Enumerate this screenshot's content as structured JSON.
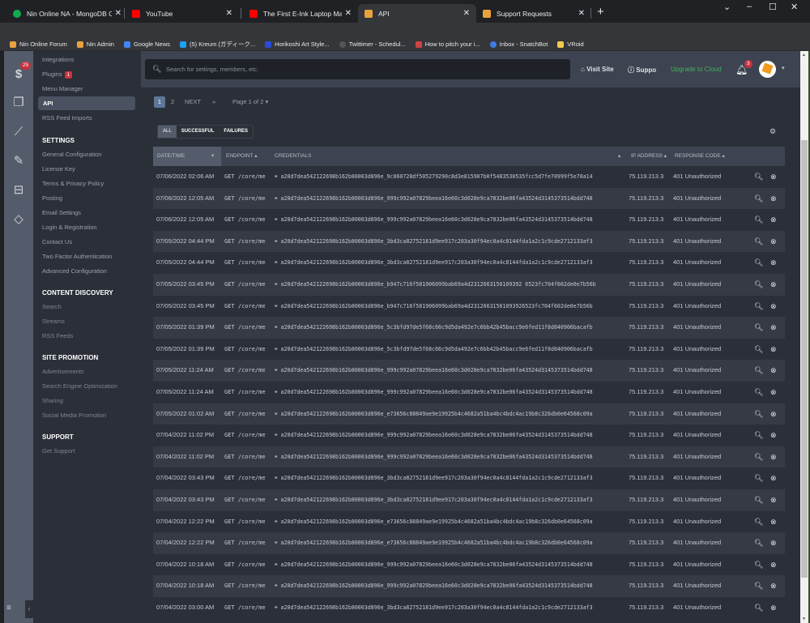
{
  "browser": {
    "tabs": [
      {
        "title": "Nin Online NA - MongoDB Charts",
        "favicon_color": "#13aa52",
        "active": false
      },
      {
        "title": "YouTube",
        "favicon_color": "#ff0000",
        "active": false
      },
      {
        "title": "The First E-Ink Laptop Makes Sen",
        "favicon_color": "#ff0000",
        "active": false
      },
      {
        "title": "API",
        "favicon_color": "#e8a33d",
        "active": true
      },
      {
        "title": "Support Requests",
        "favicon_color": "#e8a33d",
        "active": false
      }
    ],
    "new_tab": "+",
    "url_host": "ninonline.org",
    "url_path": "/forum/admin/?app=core&module=applications&controller=api&tab=apiLogs&sortby=date&sortdirection=desc",
    "bookmarks": [
      {
        "label": "Nin Online Forum",
        "color": "#e8a33d"
      },
      {
        "label": "Nin Admin",
        "color": "#e8a33d"
      },
      {
        "label": "Google News",
        "color": "#4285f4"
      },
      {
        "label": "(5) Kreum (ガディーク...",
        "color": "#1da1f2"
      },
      {
        "label": "Horikoshi Art Style...",
        "color": "#2b4bd8"
      },
      {
        "label": "Twittimer - Schedul...",
        "color": "#555555"
      },
      {
        "label": "How to pitch your i...",
        "color": "#cc4444"
      },
      {
        "label": "Inbox - SnatchBot",
        "color": "#3f7be8"
      },
      {
        "label": "VRoid",
        "color": "#f2c94c"
      }
    ]
  },
  "rail": {
    "badge": "25",
    "icons": [
      "dollar-icon",
      "copy-icon",
      "chart-line-icon",
      "brush-icon",
      "basket-icon",
      "diamond-icon"
    ]
  },
  "sidebar": {
    "items_top": [
      {
        "label": "Integrations"
      },
      {
        "label": "Plugins",
        "badge": "1"
      },
      {
        "label": "Menu Manager"
      },
      {
        "label": "API",
        "active": true
      },
      {
        "label": "RSS Feed Imports"
      }
    ],
    "sections": [
      {
        "title": "SETTINGS",
        "items": [
          "General Configuration",
          "License Key",
          "Terms & Privacy Policy",
          "Posting",
          "Email Settings",
          "Login & Registration",
          "Contact Us",
          "Two Factor Authentication",
          "Advanced Configuration"
        ]
      },
      {
        "title": "CONTENT DISCOVERY",
        "items": [
          "Search",
          "Streams",
          "RSS Feeds"
        ]
      },
      {
        "title": "SITE PROMOTION",
        "items": [
          "Advertisements",
          "Search Engine Optimization",
          "Sharing",
          "Social Media Promotion"
        ]
      },
      {
        "title": "SUPPORT",
        "items": [
          "Get Support"
        ]
      }
    ]
  },
  "topbar": {
    "search_placeholder": "Search for settings, members, etc.",
    "visit_site": "Visit Site",
    "support": "Suppo",
    "upgrade": "Upgrade to Cloud",
    "notifications": "3"
  },
  "pagination": {
    "current": "1",
    "next_page": "2",
    "next": "NEXT",
    "last": "»",
    "page_of": "Page 1 of 2 ▾"
  },
  "filters": {
    "all": "ALL",
    "successful": "SUCCESSFUL",
    "failures": "FAILURES",
    "active": "ALL"
  },
  "table": {
    "headers": {
      "date": "DATE/TIME",
      "endpoint": "ENDPOINT",
      "credentials": "CREDENTIALS",
      "ip": "IP ADDRESS",
      "response": "RESPONSE CODE"
    },
    "rows": [
      {
        "date": "07/06/2022 02:06 AM",
        "endpoint": "GET /core/me",
        "credentials": "a20d7dea542122698b162b80003d896e_9c060728df505279290c8d3e815907b0f5483530535fcc5d7fe70999f5e78a14",
        "ip": "75.119.213.3",
        "response": "401 Unauthorized"
      },
      {
        "date": "07/06/2022 12:05 AM",
        "endpoint": "GET /core/me",
        "credentials": "a20d7dea542122698b162b80003d896e_999c992a07829beea16e60c3d028e9ca7832be06fa43524d3145373514bdd748",
        "ip": "75.119.213.3",
        "response": "401 Unauthorized"
      },
      {
        "date": "07/06/2022 12:05 AM",
        "endpoint": "GET /core/me",
        "credentials": "a20d7dea542122698b162b80003d896e_999c992a07829beea16e60c3d028e9ca7832be06fa43524d3145373514bdd748",
        "ip": "75.119.213.3",
        "response": "401 Unauthorized"
      },
      {
        "date": "07/05/2022 04:44 PM",
        "endpoint": "GET /core/me",
        "credentials": "a20d7dea542122698b162b80003d896e_3bd3ca82752181d9ee917c203a30f94ec0a4c8144fda1a2c1c9cde2712133af3",
        "ip": "75.119.213.3",
        "response": "401 Unauthorized"
      },
      {
        "date": "07/05/2022 04:44 PM",
        "endpoint": "GET /core/me",
        "credentials": "a20d7dea542122698b162b80003d896e_3bd3ca82752181d9ee917c203a30f94ec0a4c8144fda1a2c1c9cde2712133af3",
        "ip": "75.119.213.3",
        "response": "401 Unauthorized"
      },
      {
        "date": "07/05/2022 03:45 PM",
        "endpoint": "GET /core/me",
        "credentials": "a20d7dea542122698b162b80003d896e_b947c716f581906099bab69a4d2312663156109392 6523fc704f602de0e7b56b",
        "ip": "75.119.213.3",
        "response": "401 Unauthorized"
      },
      {
        "date": "07/05/2022 03:45 PM",
        "endpoint": "GET /core/me",
        "credentials": "a20d7dea542122698b162b80003d896e_b947c716f581906099bab69a4d23126631561093926523fc704f602de0e7b56b",
        "ip": "75.119.213.3",
        "response": "401 Unauthorized"
      },
      {
        "date": "07/05/2022 01:39 PM",
        "endpoint": "GET /core/me",
        "credentials": "a20d7dea542122698b162b80003d896e_5c3bfd97de5f68c66c9d5da492e7c6bb42b45bacc9e6fed11f8d040906bacafb",
        "ip": "75.119.213.3",
        "response": "401 Unauthorized"
      },
      {
        "date": "07/05/2022 01:39 PM",
        "endpoint": "GET /core/me",
        "credentials": "a20d7dea542122698b162b80003d896e_5c3bfd97de5f68c66c9d5da492e7c6bb42b45bacc9e6fed11f8d040906bacafb",
        "ip": "75.119.213.3",
        "response": "401 Unauthorized"
      },
      {
        "date": "07/05/2022 11:24 AM",
        "endpoint": "GET /core/me",
        "credentials": "a20d7dea542122698b162b80003d896e_999c992a07829beea16e60c3d028e9ca7832be06fa43524d3145373514bdd748",
        "ip": "75.119.213.3",
        "response": "401 Unauthorized"
      },
      {
        "date": "07/05/2022 11:24 AM",
        "endpoint": "GET /core/me",
        "credentials": "a20d7dea542122698b162b80003d896e_999c992a07829beea16e60c3d028e9ca7832be06fa43524d3145373514bdd748",
        "ip": "75.119.213.3",
        "response": "401 Unauthorized"
      },
      {
        "date": "07/05/2022 01:02 AM",
        "endpoint": "GET /core/me",
        "credentials": "a20d7dea542122698b162b80003d896e_e73656c88849ae9e19925b4c4682a51ba4bc4bdc4ac19b8c326db0e64568c09a",
        "ip": "75.119.213.3",
        "response": "401 Unauthorized"
      },
      {
        "date": "07/04/2022 11:02 PM",
        "endpoint": "GET /core/me",
        "credentials": "a20d7dea542122698b162b80003d896e_999c992a07829beea16e60c3d028e9ca7832be06fa43524d3145373514bdd748",
        "ip": "75.119.213.3",
        "response": "401 Unauthorized"
      },
      {
        "date": "07/04/2022 11:02 PM",
        "endpoint": "GET /core/me",
        "credentials": "a20d7dea542122698b162b80003d896e_999c992a07829beea16e60c3d028e9ca7832be06fa43524d3145373514bdd748",
        "ip": "75.119.213.3",
        "response": "401 Unauthorized"
      },
      {
        "date": "07/04/2022 03:43 PM",
        "endpoint": "GET /core/me",
        "credentials": "a20d7dea542122698b162b80003d896e_3bd3ca82752181d9ee917c203a30f94ec0a4c8144fda1a2c1c9cde2712133af3",
        "ip": "75.119.213.3",
        "response": "401 Unauthorized"
      },
      {
        "date": "07/04/2022 03:43 PM",
        "endpoint": "GET /core/me",
        "credentials": "a20d7dea542122698b162b80003d896e_3bd3ca82752181d9ee917c203a30f94ec0a4c8144fda1a2c1c9cde2712133af3",
        "ip": "75.119.213.3",
        "response": "401 Unauthorized"
      },
      {
        "date": "07/04/2022 12:22 PM",
        "endpoint": "GET /core/me",
        "credentials": "a20d7dea542122698b162b80003d896e_e73656c88849ae9e19925b4c4682a51ba4bc4bdc4ac19b8c326db0e64568c09a",
        "ip": "75.119.213.3",
        "response": "401 Unauthorized"
      },
      {
        "date": "07/04/2022 12:22 PM",
        "endpoint": "GET /core/me",
        "credentials": "a20d7dea542122698b162b80003d896e_e73656c88849ae9e19925b4c4682a51ba4bc4bdc4ac19b8c326db0e64568c09a",
        "ip": "75.119.213.3",
        "response": "401 Unauthorized"
      },
      {
        "date": "07/04/2022 10:18 AM",
        "endpoint": "GET /core/me",
        "credentials": "a20d7dea542122698b162b80003d896e_999c992a07829beea16e60c3d028e9ca7832be06fa43524d3145373514bdd748",
        "ip": "75.119.213.3",
        "response": "401 Unauthorized"
      },
      {
        "date": "07/04/2022 10:18 AM",
        "endpoint": "GET /core/me",
        "credentials": "a20d7dea542122698b162b80003d896e_999c992a07829beea16e60c3d028e9ca7832be06fa43524d3145373514bdd748",
        "ip": "75.119.213.3",
        "response": "401 Unauthorized"
      },
      {
        "date": "07/04/2022 03:00 AM",
        "endpoint": "GET /core/me",
        "credentials": "a20d7dea542122698b162b80003d896e_3bd3ca82752181d9ee917c203a30f94ec0a4c8144fda1a2c1c9cde2712133af3",
        "ip": "75.119.213.3",
        "response": "401 Unauthorized"
      }
    ]
  }
}
